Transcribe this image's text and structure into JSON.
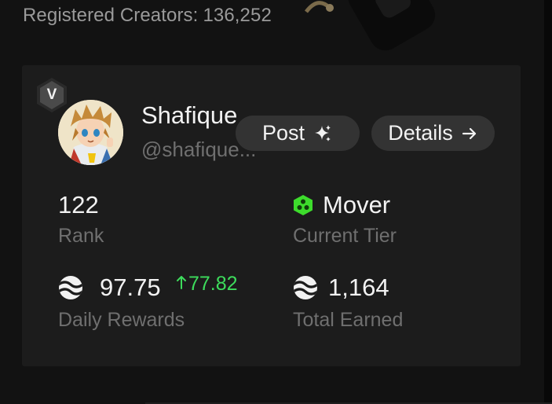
{
  "header": {
    "registered_label": "Registered Creators:",
    "registered_count": "136,252"
  },
  "profile": {
    "verified_letter": "V",
    "name": "Shafique",
    "handle": "@shafique..."
  },
  "actions": {
    "post_label": "Post",
    "post_icon": "sparkles-icon",
    "details_label": "Details",
    "details_icon": "arrow-right-icon"
  },
  "stats": {
    "rank_value": "122",
    "rank_label": "Rank",
    "tier_value": "Mover",
    "tier_label": "Current Tier",
    "tier_icon": "mover-hexagon-icon",
    "tier_color": "#3ddc2c",
    "daily_value": "97.75",
    "daily_change": "77.82",
    "daily_change_color": "#3ddc5c",
    "daily_label": "Daily Rewards",
    "daily_icon": "token-icon",
    "total_value": "1,164",
    "total_label": "Total Earned",
    "total_icon": "token-icon"
  }
}
